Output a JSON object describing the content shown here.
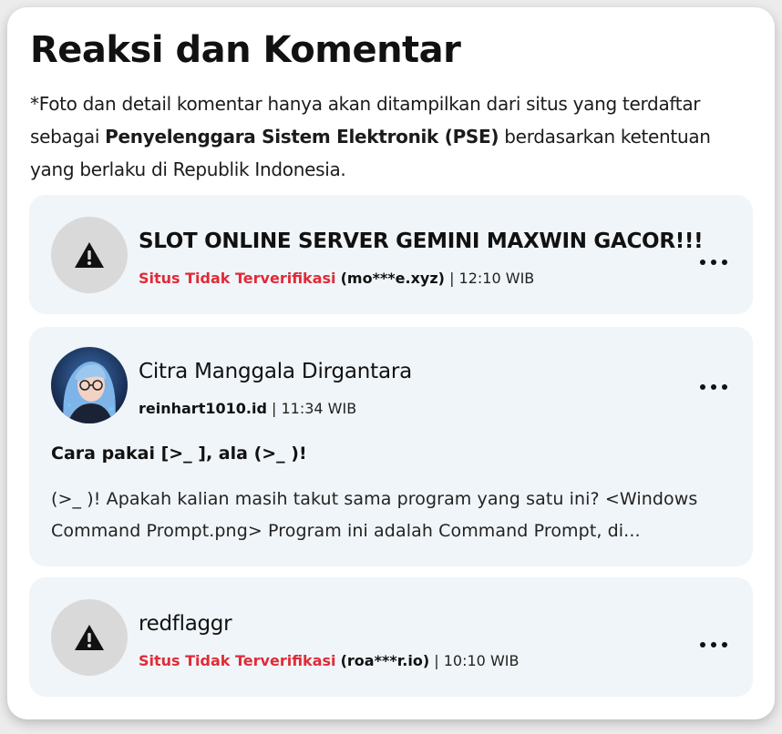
{
  "section": {
    "title": "Reaksi dan Komentar",
    "notice_prefix": "*Foto dan detail komentar hanya akan ditampilkan dari situs yang terdaftar sebagai ",
    "notice_bold": "Penyelenggara Sistem Elektronik (PSE)",
    "notice_suffix": " berdasarkan ketentuan yang berlaku di Republik Indonesia."
  },
  "comments": [
    {
      "name": "SLOT ONLINE SERVER GEMINI MAXWIN GACOR!!!",
      "warning": "Situs Tidak Terverifikasi",
      "source": "(mo***e.xyz)",
      "time": "| 12:10 WIB",
      "avatar_icon": "warning-triangle-icon"
    },
    {
      "name": "Citra Manggala Dirgantara",
      "source": "reinhart1010.id",
      "time": "| 11:34 WIB",
      "post_title": "Cara pakai [>_ ], ala (>_ )!",
      "post_excerpt": "(>_ )! Apakah kalian masih takut sama program yang satu ini? <Windows Command Prompt.png> Program ini adalah Command Prompt, di..."
    },
    {
      "name": "redflaggr",
      "warning": "Situs Tidak Terverifikasi",
      "source": "(roa***r.io)",
      "time": "| 10:10 WIB",
      "avatar_icon": "warning-triangle-icon"
    }
  ],
  "colors": {
    "warning_text": "#e02b38",
    "card_bg": "#f0f5f9",
    "avatar_placeholder": "#d9d9d9"
  }
}
